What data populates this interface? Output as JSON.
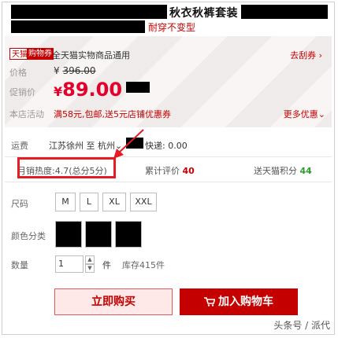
{
  "title": {
    "text": "秋衣秋裤套装",
    "subtitle": "耐穿不变型"
  },
  "voucher": {
    "tag_tmall": "天猫",
    "tag_voucher": "购物券",
    "description": "全天猫实物商品通用",
    "action": "去刮券"
  },
  "price": {
    "label": "价格",
    "currency": "¥",
    "original": "396.00",
    "promo_label": "促销价",
    "promo_value": "89.00"
  },
  "promotion": {
    "label": "本店活动",
    "text": "满58元,包邮,送5元店铺优惠券",
    "more": "更多优惠"
  },
  "shipping": {
    "label": "运费",
    "text": "江苏徐州  至  杭州",
    "fee_label": "快递: 0.00"
  },
  "stats": {
    "sales": "月销热度:4.7(总分5分)",
    "reviews_label": "累计评价",
    "reviews_count": "40",
    "points_label": "送天猫积分",
    "points_count": "44"
  },
  "sizes": {
    "label": "尺码",
    "options": [
      "M",
      "L",
      "XL",
      "XXL"
    ]
  },
  "colors": {
    "label": "颜色分类"
  },
  "quantity": {
    "label": "数量",
    "value": "1",
    "unit": "件",
    "stock": "库存415件"
  },
  "actions": {
    "buy_now": "立即购买",
    "add_to_cart": "加入购物车"
  },
  "watermark": "头条号 / 派代",
  "colors_theme": {
    "accent": "#c40000",
    "highlight": "#e51c23",
    "green": "#2a9d2a"
  }
}
